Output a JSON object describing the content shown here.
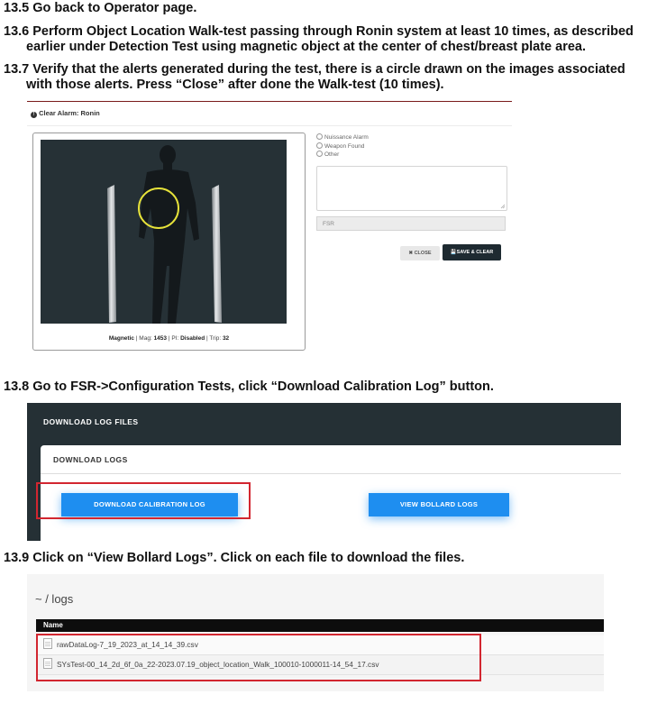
{
  "steps": {
    "s135": "13.5 Go back to Operator page.",
    "s136_line1": "13.6 Perform Object Location Walk-test passing through Ronin system at least 10 times, as described",
    "s136_line2": "earlier under Detection Test using magnetic object at the center of chest/breast plate area.",
    "s137_line1": "13.7 Verify that the alerts generated during the test, there is a circle drawn on the images associated",
    "s137_line2": "with those alerts. Press “Close” after done the Walk-test (10 times).",
    "s138": "13.8 Go to FSR->Configuration Tests, click “Download Calibration Log” button.",
    "s139": "13.9 Click on “View Bollard Logs”. Click on each file to download the files."
  },
  "alarm_dialog": {
    "title": "Clear Alarm: Ronin",
    "title_icon": "exclamation-circle-icon",
    "caption_prefix": "Magnetic",
    "caption_mag_label": "| Mag: ",
    "caption_mag_value": "1453",
    "caption_pi_label": " | PI: ",
    "caption_pi_value": "Disabled",
    "caption_trip_label": " | Trip: ",
    "caption_trip_value": "32",
    "options": [
      "Nuissance Alarm",
      "Weapon Found",
      "Other"
    ],
    "fsr_placeholder": "FSR",
    "close_label": "✖ CLOSE",
    "save_label": "💾SAVE & CLEAR",
    "circle_color": "#e6e23a"
  },
  "download_panel": {
    "panel_title": "DOWNLOAD LOG FILES",
    "card_title": "DOWNLOAD LOGS",
    "calibration_button": "DOWNLOAD CALIBRATION LOG",
    "bollard_button": "VIEW BOLLARD LOGS",
    "button_color": "#1e8ef0",
    "highlight_color": "#d22630"
  },
  "logs_listing": {
    "path": "~ / logs",
    "column_header": "Name",
    "files": [
      "rawDataLog-7_19_2023_at_14_14_39.csv",
      "SYsTest-00_14_2d_6f_0a_22-2023.07.19_object_location_Walk_100010-1000011-14_54_17.csv"
    ]
  }
}
